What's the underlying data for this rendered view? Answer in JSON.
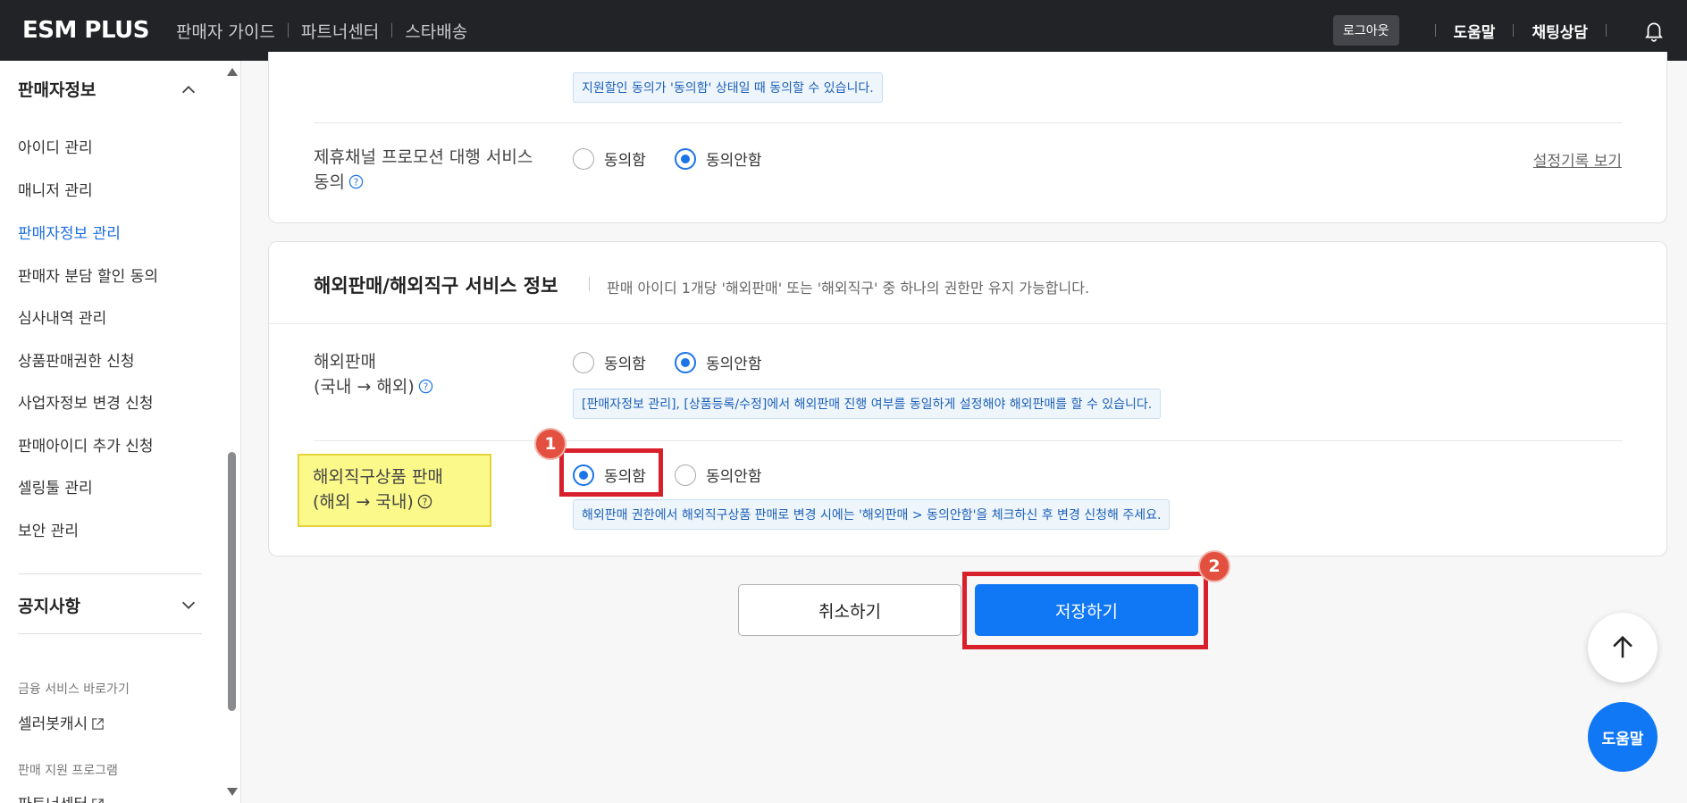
{
  "header": {
    "logo": "ESM PLUS",
    "nav": [
      "판매자 가이드",
      "파트너센터",
      "스타배송"
    ],
    "logout": "로그아웃",
    "help": "도움말",
    "chat": "채팅상담"
  },
  "sidebar": {
    "section_title": "판매자정보",
    "items": [
      {
        "label": "아이디 관리"
      },
      {
        "label": "매니저 관리"
      },
      {
        "label": "판매자정보 관리"
      },
      {
        "label": "판매자 분담 할인 동의"
      },
      {
        "label": "심사내역 관리"
      },
      {
        "label": "상품판매권한 신청"
      },
      {
        "label": "사업자정보 변경 신청"
      },
      {
        "label": "판매아이디 추가 신청"
      },
      {
        "label": "셀링툴 관리"
      },
      {
        "label": "보안 관리"
      }
    ],
    "notice_title": "공지사항",
    "finance_label": "금융 서비스 바로가기",
    "finance_link": "셀러봇캐시",
    "support_label": "판매 지원 프로그램",
    "support_link": "파트너센터"
  },
  "panel1": {
    "info_top": "지원할인 동의가 '동의함' 상태일 때 동의할 수 있습니다.",
    "row_label_line1": "제휴채널 프로모션 대행 서비스",
    "row_label_line2": "동의",
    "agree": "동의함",
    "disagree": "동의안함",
    "selected": "disagree",
    "history_link": "설정기록 보기"
  },
  "panel2": {
    "title": "해외판매/해외직구 서비스 정보",
    "desc": "판매 아이디 1개당 '해외판매' 또는 '해외직구' 중 하나의 권한만 유지 가능합니다.",
    "row1": {
      "label_line1": "해외판매",
      "label_line2": "(국내 → 해외)",
      "agree": "동의함",
      "disagree": "동의안함",
      "selected": "disagree",
      "info": "[판매자정보 관리], [상품등록/수정]에서 해외판매 진행 여부를 동일하게 설정해야 해외판매를 할 수 있습니다."
    },
    "row2": {
      "label_line1": "해외직구상품 판매",
      "label_line2": "(해외 → 국내)",
      "agree": "동의함",
      "disagree": "동의안함",
      "selected": "agree",
      "info": "해외판매 권한에서 해외직구상품 판매로 변경 시에는 '해외판매 > 동의안함'을 체크하신 후 변경 신청해 주세요."
    }
  },
  "actions": {
    "cancel": "취소하기",
    "save": "저장하기"
  },
  "annotations": {
    "badge1": "1",
    "badge2": "2"
  },
  "floating": {
    "help": "도움말"
  },
  "colors": {
    "accent": "#1078f5",
    "highlight_red": "#d8202c",
    "highlight_yellow": "#fbf98a"
  }
}
